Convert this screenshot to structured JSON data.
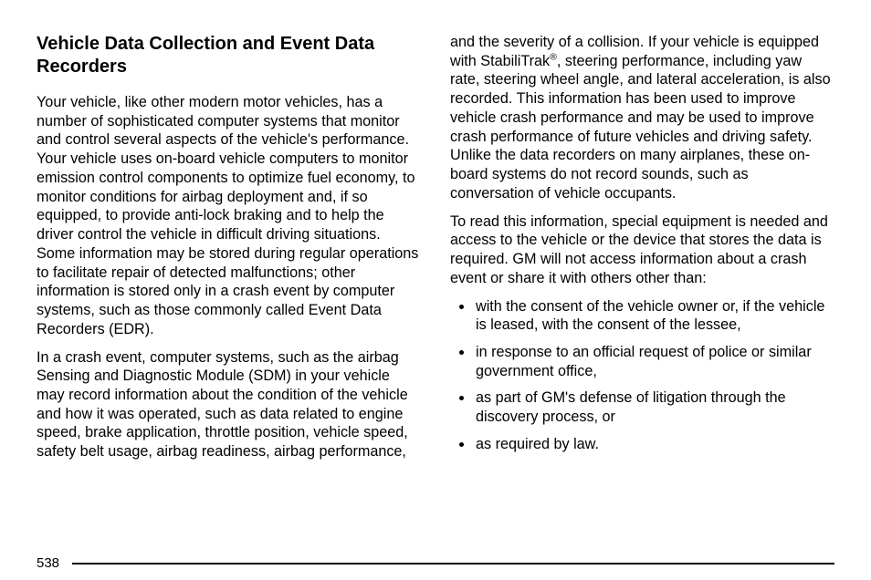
{
  "title": "Vehicle Data Collection and Event Data Recorders",
  "left": {
    "p1": "Your vehicle, like other modern motor vehicles, has a number of sophisticated computer systems that monitor and control several aspects of the vehicle's performance. Your vehicle uses on-board vehicle computers to monitor emission control components to optimize fuel economy, to monitor conditions for airbag deployment and, if so equipped, to provide anti-lock braking and to help the driver control the vehicle in difficult driving situations. Some information may be stored during regular operations to facilitate repair of detected malfunctions; other information is stored only in a crash event by computer systems, such as those commonly called Event Data Recorders (EDR).",
    "p2": "In a crash event, computer systems, such as the airbag Sensing and Diagnostic Module (SDM) in your vehicle may record information about the condition of the vehicle and how it was operated, such as data related to engine speed, brake application, throttle position, vehicle speed, safety belt usage, airbag readiness, airbag performance,"
  },
  "right": {
    "p1_a": "and the severity of a collision. If your vehicle is equipped with StabiliTrak",
    "p1_sup": "®",
    "p1_b": ", steering performance, including yaw rate, steering wheel angle, and lateral acceleration, is also recorded. This information has been used to improve vehicle crash performance and may be used to improve crash performance of future vehicles and driving safety. Unlike the data recorders on many airplanes, these on-board systems do not record sounds, such as conversation of vehicle occupants.",
    "p2": "To read this information, special equipment is needed and access to the vehicle or the device that stores the data is required. GM will not access information about a crash event or share it with others other than:",
    "bullets": [
      "with the consent of the vehicle owner or, if the vehicle is leased, with the consent of the lessee,",
      "in response to an official request of police or similar government office,",
      "as part of GM's defense of litigation through the discovery process, or",
      "as required by law."
    ]
  },
  "page_number": "538"
}
